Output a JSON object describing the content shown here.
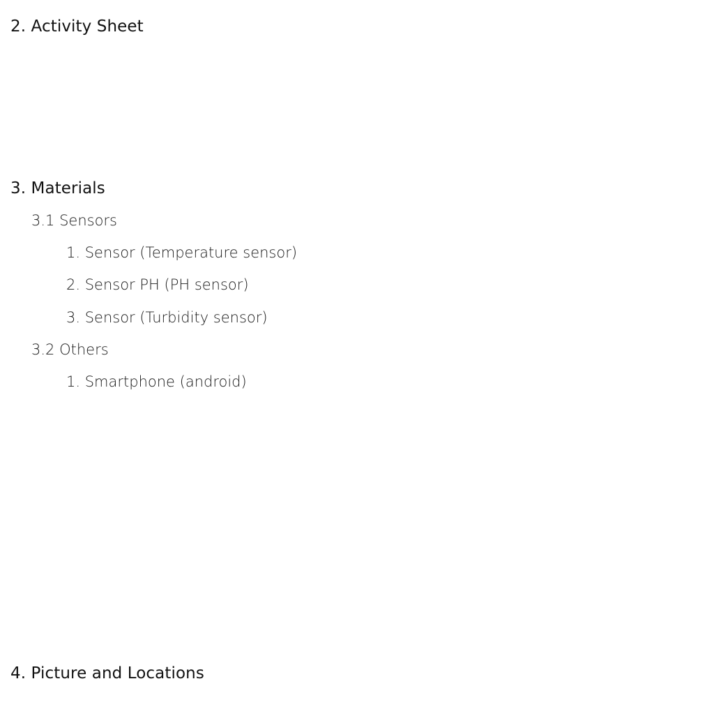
{
  "sections": [
    {
      "heading": "2. Activity Sheet"
    },
    {
      "heading": "3. Materials",
      "subsections": [
        {
          "label": "3.1 Sensors",
          "items": [
            "1. Sensor (Temperature sensor)",
            "2. Sensor PH (PH sensor)",
            "3. Sensor (Turbidity sensor)"
          ]
        },
        {
          "label": "3.2 Others",
          "items": [
            "1. Smartphone (android)"
          ]
        }
      ]
    },
    {
      "heading": "4. Picture and Locations"
    }
  ]
}
